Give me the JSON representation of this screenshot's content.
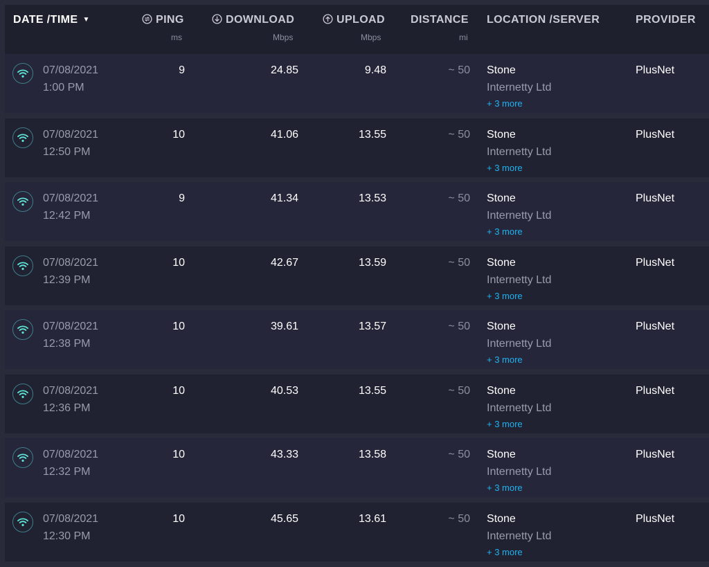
{
  "header": {
    "date_time": "DATE /TIME",
    "ping": "PING",
    "ping_unit": "ms",
    "download": "DOWNLOAD",
    "download_unit": "Mbps",
    "upload": "UPLOAD",
    "upload_unit": "Mbps",
    "distance": "DISTANCE",
    "distance_unit": "mi",
    "location": "LOCATION /SERVER",
    "provider": "PROVIDER"
  },
  "icons": {
    "sort": "caret-down-icon",
    "ping": "ping-icon",
    "download": "download-arrow-icon",
    "upload": "upload-arrow-icon",
    "connection": "wifi-icon"
  },
  "colors": {
    "accent": "#5fe3d5",
    "link": "#1fb3f0"
  },
  "results": [
    {
      "date": "07/08/2021",
      "time": "1:00 PM",
      "ping": "9",
      "download": "24.85",
      "upload": "9.48",
      "distance": "~ 50",
      "location": "Stone",
      "sponsor": "Internetty Ltd",
      "more": "+ 3 more",
      "provider": "PlusNet"
    },
    {
      "date": "07/08/2021",
      "time": "12:50 PM",
      "ping": "10",
      "download": "41.06",
      "upload": "13.55",
      "distance": "~ 50",
      "location": "Stone",
      "sponsor": "Internetty Ltd",
      "more": "+ 3 more",
      "provider": "PlusNet"
    },
    {
      "date": "07/08/2021",
      "time": "12:42 PM",
      "ping": "9",
      "download": "41.34",
      "upload": "13.53",
      "distance": "~ 50",
      "location": "Stone",
      "sponsor": "Internetty Ltd",
      "more": "+ 3 more",
      "provider": "PlusNet"
    },
    {
      "date": "07/08/2021",
      "time": "12:39 PM",
      "ping": "10",
      "download": "42.67",
      "upload": "13.59",
      "distance": "~ 50",
      "location": "Stone",
      "sponsor": "Internetty Ltd",
      "more": "+ 3 more",
      "provider": "PlusNet"
    },
    {
      "date": "07/08/2021",
      "time": "12:38 PM",
      "ping": "10",
      "download": "39.61",
      "upload": "13.57",
      "distance": "~ 50",
      "location": "Stone",
      "sponsor": "Internetty Ltd",
      "more": "+ 3 more",
      "provider": "PlusNet"
    },
    {
      "date": "07/08/2021",
      "time": "12:36 PM",
      "ping": "10",
      "download": "40.53",
      "upload": "13.55",
      "distance": "~ 50",
      "location": "Stone",
      "sponsor": "Internetty Ltd",
      "more": "+ 3 more",
      "provider": "PlusNet"
    },
    {
      "date": "07/08/2021",
      "time": "12:32 PM",
      "ping": "10",
      "download": "43.33",
      "upload": "13.58",
      "distance": "~ 50",
      "location": "Stone",
      "sponsor": "Internetty Ltd",
      "more": "+ 3 more",
      "provider": "PlusNet"
    },
    {
      "date": "07/08/2021",
      "time": "12:30 PM",
      "ping": "10",
      "download": "45.65",
      "upload": "13.61",
      "distance": "~ 50",
      "location": "Stone",
      "sponsor": "Internetty Ltd",
      "more": "+ 3 more",
      "provider": "PlusNet"
    }
  ]
}
